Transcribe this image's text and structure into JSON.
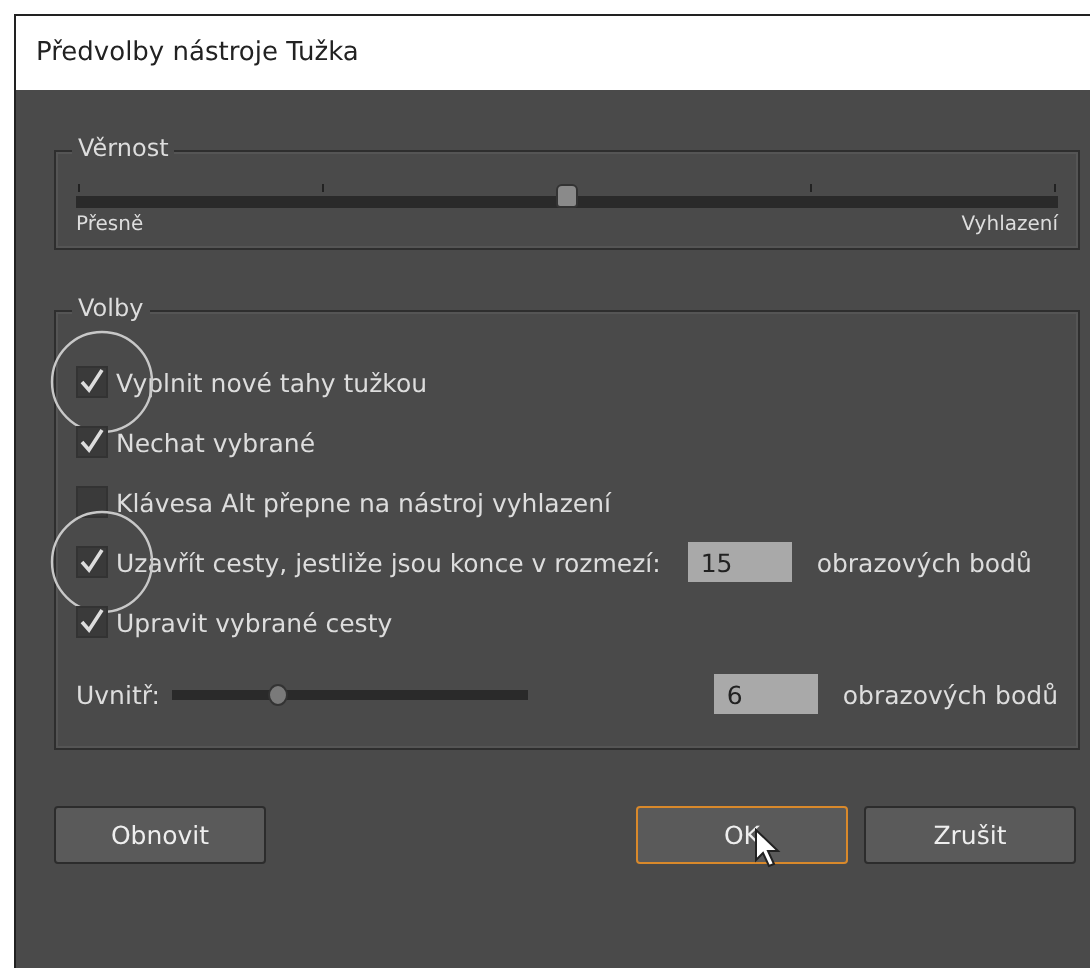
{
  "window": {
    "title": "Předvolby nástroje Tužka"
  },
  "fidelity": {
    "legend": "Věrnost",
    "level": 0.5,
    "min_label": "Přesně",
    "max_label": "Vyhlazení"
  },
  "options": {
    "legend": "Volby",
    "items": [
      {
        "kind": "checkbox",
        "label": "Vyplnit nové tahy tužkou",
        "checked": true,
        "highlighted": true
      },
      {
        "kind": "checkbox",
        "label": "Nechat vybrané",
        "checked": true,
        "highlighted": false
      },
      {
        "kind": "checkbox",
        "label": "Klávesa Alt přepne na nástroj vyhlazení",
        "checked": false,
        "highlighted": false
      },
      {
        "kind": "checkbox-field",
        "label": "Uzavřít cesty, jestliže jsou konce v rozmezí:",
        "checked": true,
        "highlighted": true,
        "value": "15",
        "unit": "obrazových bodů"
      },
      {
        "kind": "checkbox",
        "label": "Upravit vybrané cesty",
        "checked": true,
        "highlighted": false
      },
      {
        "kind": "slider",
        "label": "Uvnitř:",
        "level": 0.3,
        "value": "6",
        "unit": "obrazových bodů"
      }
    ]
  },
  "buttons": [
    {
      "label": "Obnovit",
      "focused": false,
      "pointer": false
    },
    {
      "label": "OK",
      "focused": true,
      "pointer": true
    },
    {
      "label": "Zrušit",
      "focused": false,
      "pointer": false
    }
  ]
}
